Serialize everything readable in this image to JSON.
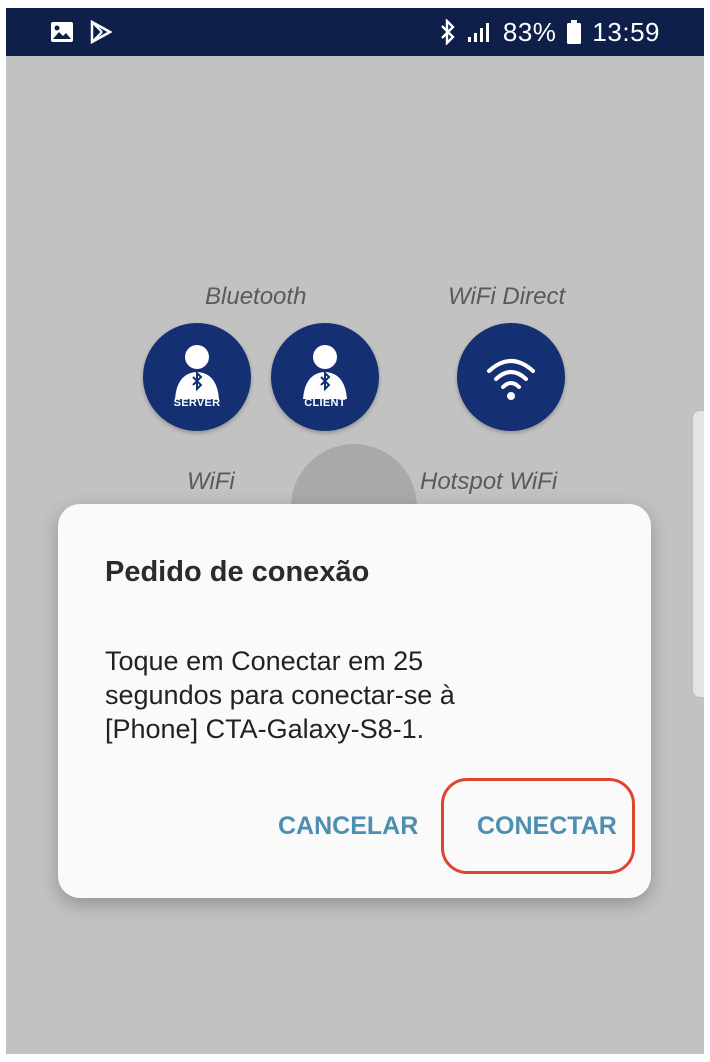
{
  "status_bar": {
    "icons_left": [
      "gallery-icon",
      "play-store-icon"
    ],
    "icons_right": [
      "bluetooth-icon",
      "signal-icon",
      "battery-icon"
    ],
    "battery": "83%",
    "time": "13:59",
    "background": "#0e1f4a"
  },
  "connection_options": {
    "bluetooth_label": "Bluetooth",
    "wifi_direct_label": "WiFi Direct",
    "wifi_label": "WiFi",
    "hotspot_label": "Hotspot WiFi",
    "server_caption": "SERVER",
    "client_caption": "CLIENT",
    "button_color": "#143072"
  },
  "dialog": {
    "title": "Pedido de conexão",
    "message_lines": [
      "Toque em Conectar em 25",
      "segundos para conectar-se à",
      "[Phone] CTA-Galaxy-S8-1."
    ],
    "cancel_label": "CANCELAR",
    "confirm_label": "CONECTAR",
    "button_color": "#4d8fb0",
    "highlight_color": "#e0442f"
  }
}
